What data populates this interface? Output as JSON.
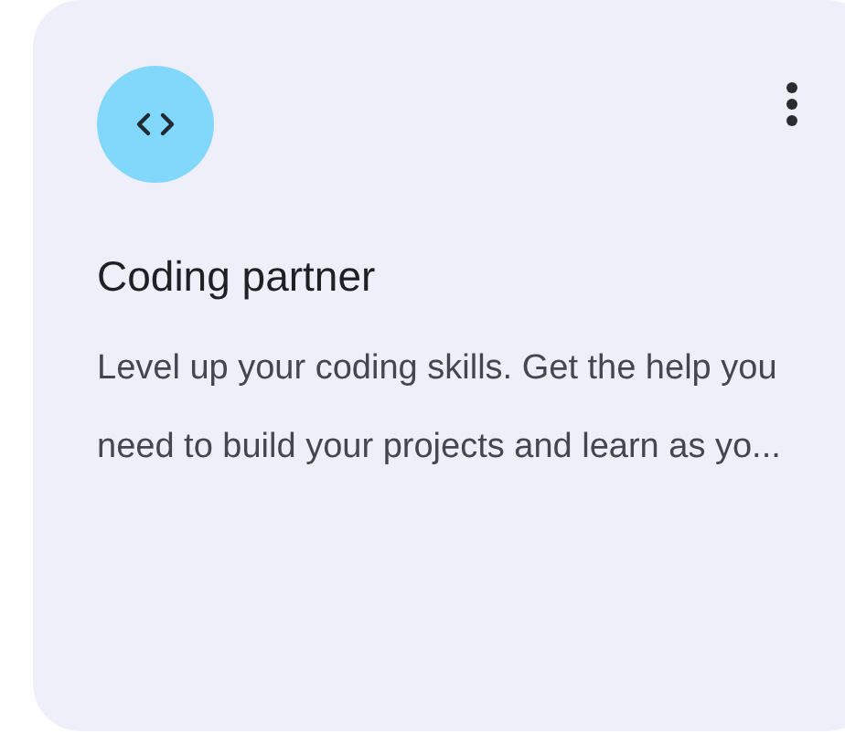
{
  "card": {
    "title": "Coding partner",
    "description": "Level up your coding skills. Get the help you need to build your projects and learn as yo..."
  }
}
